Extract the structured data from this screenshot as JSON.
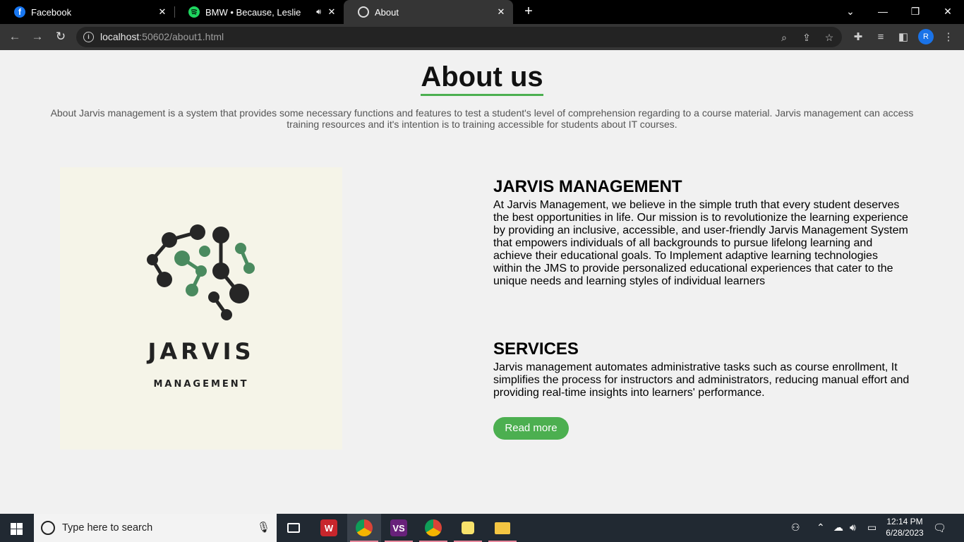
{
  "browser": {
    "tabs": [
      {
        "title": "Facebook",
        "icon": "facebook-icon"
      },
      {
        "title": "BMW • Because, Leslie",
        "icon": "spotify-icon"
      },
      {
        "title": "About",
        "icon": "globe-icon"
      }
    ],
    "active_tab": 2,
    "url_host": "localhost",
    "url_rest": ":50602/about1.html",
    "profile_initial": "R"
  },
  "page": {
    "title": "About us",
    "intro": "About Jarvis management is a system that provides some necessary functions and features to test a student's level of comprehension regarding to a course material. Jarvis management can access training resources and it's intention is to training accessible for students about IT courses.",
    "logo": {
      "word": "JARVIS",
      "subword": "MANAGEMENT"
    },
    "section1": {
      "title": "JARVIS MANAGEMENT",
      "text": "At Jarvis Management, we believe in the simple truth that every student deserves the best opportunities in life. Our mission is to revolutionize the learning experience by providing an inclusive, accessible, and user-friendly Jarvis Management System that empowers individuals of all backgrounds to pursue lifelong learning and achieve their educational goals. To Implement adaptive learning technologies within the JMS to provide personalized educational experiences that cater to the unique needs and learning styles of individual learners"
    },
    "section2": {
      "title": "SERVICES",
      "text": "Jarvis management automates administrative tasks such as course enrollment, It simplifies the process for instructors and administrators, reducing manual effort and providing real-time insights into learners' performance."
    },
    "read_more_label": "Read more",
    "accent_color": "#4caf50"
  },
  "taskbar": {
    "search_placeholder": "Type here to search",
    "time": "12:14 PM",
    "date": "6/28/2023"
  }
}
